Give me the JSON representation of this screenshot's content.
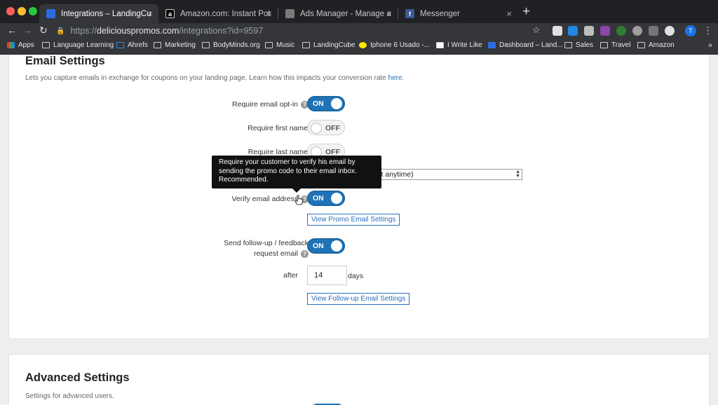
{
  "browser": {
    "tabs": [
      {
        "title": "Integrations – LandingCube",
        "fav_color": "#2d6cdf",
        "fav_char": ""
      },
      {
        "title": "Amazon.com: Instant Pot Duo",
        "fav_color": "#000000",
        "fav_char": "a"
      },
      {
        "title": "Ads Manager - Manage ads - C",
        "fav_color": "#7a7a7a",
        "fav_char": ""
      },
      {
        "title": "Messenger",
        "fav_color": "#3b5998",
        "fav_char": "f"
      }
    ],
    "close_glyph": "×",
    "new_tab_glyph": "+",
    "url_scheme": "https://",
    "url_host": "deliciouspromos.com",
    "url_path": "/integrations?id=9597",
    "profile_initial": "T",
    "bookmarks": [
      {
        "label": "Apps",
        "icon": "apps-grid-icon"
      },
      {
        "label": "Language Learning",
        "icon": "folder-icon"
      },
      {
        "label": "Ahrefs",
        "icon": "ahrefs-icon"
      },
      {
        "label": "Marketing",
        "icon": "folder-icon"
      },
      {
        "label": "BodyMinds.org",
        "icon": "folder-icon"
      },
      {
        "label": "Music",
        "icon": "folder-icon"
      },
      {
        "label": "LandingCube",
        "icon": "folder-icon"
      },
      {
        "label": "Iphone 6 Usado -...",
        "icon": "mercadolibre-icon"
      },
      {
        "label": "I Write Like",
        "icon": "iwritelike-icon"
      },
      {
        "label": "Dashboard – Land...",
        "icon": "landingcube-icon"
      },
      {
        "label": "Sales",
        "icon": "folder-icon"
      },
      {
        "label": "Travel",
        "icon": "folder-icon"
      },
      {
        "label": "Amazon",
        "icon": "folder-icon"
      }
    ],
    "bookmarks_more": "»"
  },
  "email_settings": {
    "title": "Email Settings",
    "description": "Lets you capture emails in exchange for coupons on your landing page. Learn how this impacts your conversion rate",
    "description_link": "here",
    "description_end": ".",
    "require_opt_in": {
      "label": "Require email opt-in",
      "state": "ON"
    },
    "require_first_name": {
      "label": "Require first name",
      "state": "OFF"
    },
    "require_last_name": {
      "label": "Require last name",
      "state": "OFF"
    },
    "email_list_select": {
      "value": "r / export anytime)"
    },
    "verify_email": {
      "label": "Verify email address",
      "state": "ON"
    },
    "tooltip": "Require your customer to verify his email by sending the promo code to their email inbox. Recommended.",
    "view_promo_button": "View Promo Email Settings",
    "follow_up": {
      "label_line1": "Send follow-up / feedback",
      "label_line2": "request email",
      "state": "ON"
    },
    "after_label": "after",
    "after_days_value": "14",
    "days_label": "days",
    "view_followup_button": "View Follow-up Email Settings"
  },
  "advanced_settings": {
    "title": "Advanced Settings",
    "description": "Settings for advanced users."
  },
  "help_glyph": "?"
}
